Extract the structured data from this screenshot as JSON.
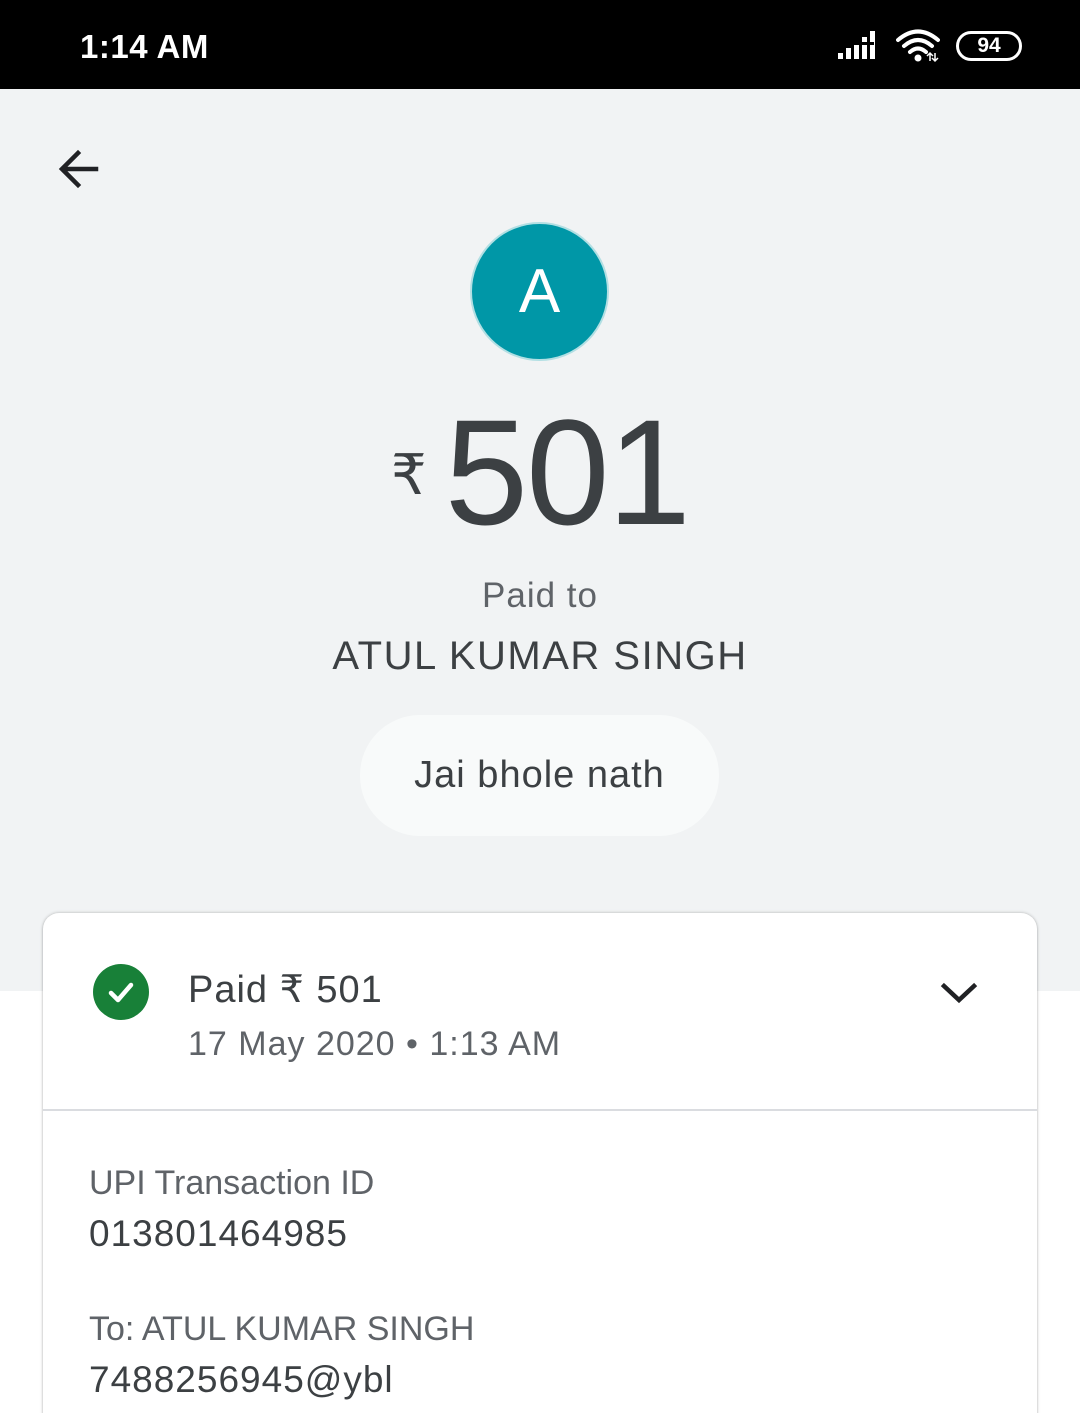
{
  "status_bar": {
    "time": "1:14 AM",
    "battery": "94",
    "icons": [
      "signal-icon",
      "wifi-icon",
      "battery-icon"
    ]
  },
  "header": {
    "back_icon": "arrow-left-icon",
    "avatar_initial": "A",
    "avatar_color": "#0097a7",
    "currency_symbol": "₹",
    "amount": "501",
    "paid_to_label": "Paid to",
    "payee_name": "ATUL KUMAR SINGH",
    "note": "Jai bhole nath"
  },
  "card": {
    "status_icon": "check-circle-icon",
    "status_color": "#188038",
    "status_title": "Paid ₹ 501",
    "status_date": "17 May 2020 • 1:13 AM",
    "expand_icon": "chevron-down-icon",
    "details": [
      {
        "label": "UPI Transaction ID",
        "value": "013801464985"
      },
      {
        "label": "To: ATUL KUMAR SINGH",
        "value": "7488256945@ybl"
      }
    ]
  }
}
